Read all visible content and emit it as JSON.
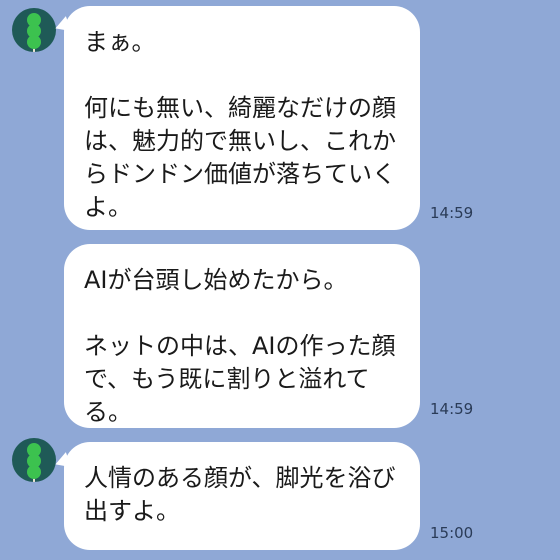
{
  "chat": {
    "messages": [
      {
        "text": "まぁ。\n\n何にも無い、綺麗なだけの顔は、魅力的で無いし、これからドンドン価値が落ちていくよ。",
        "time": "14:59"
      },
      {
        "text": "AIが台頭し始めたから。\n\nネットの中は、AIの作った顔で、もう既に割りと溢れてる。",
        "time": "14:59"
      },
      {
        "text": "人情のある顔が、脚光を浴び出すよ。",
        "time": "15:00"
      }
    ]
  },
  "colors": {
    "background": "#8fa8d6",
    "bubble": "#ffffff",
    "avatar_bg": "#1f5a57",
    "avatar_dango": "#3cc24f"
  },
  "icons": {
    "avatar": "green-dango-icon"
  }
}
